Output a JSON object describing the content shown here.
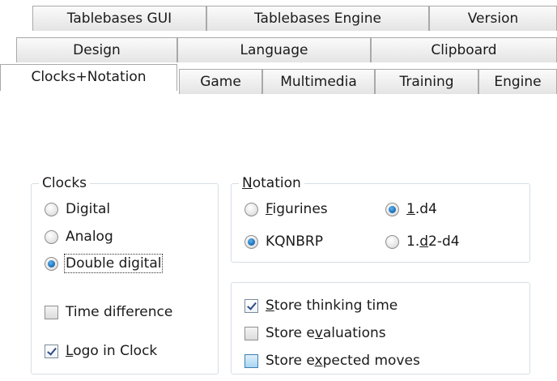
{
  "tabs": {
    "row1": [
      "Tablebases GUI",
      "Tablebases Engine",
      "Version"
    ],
    "row2": [
      "Design",
      "Language",
      "Clipboard"
    ],
    "row3": [
      "Clocks+Notation",
      "Game",
      "Multimedia",
      "Training",
      "Engine"
    ],
    "active": "Clocks+Notation"
  },
  "clocks": {
    "title": "Clocks",
    "options": [
      {
        "label": "Digital",
        "selected": false
      },
      {
        "label": "Analog",
        "selected": false
      },
      {
        "label": "Double digital",
        "selected": true
      }
    ],
    "time_difference": {
      "label": "Time difference",
      "checked": false
    },
    "logo_in_clock": {
      "label_u": "L",
      "label_rest": "ogo in Clock",
      "checked": true
    }
  },
  "notation": {
    "title_u": "N",
    "title_rest": "otation",
    "figurines": {
      "label_u": "F",
      "label_rest": "igurines",
      "selected": false
    },
    "kqnbrp": {
      "label": "KQNBRP",
      "selected": true
    },
    "short": {
      "label_u": "1",
      "label_rest": ".d4",
      "selected": true
    },
    "long": {
      "label_a": "1.",
      "label_u": "d",
      "label_rest": "2-d4",
      "selected": false
    }
  },
  "store": {
    "thinking_time": {
      "label_u": "S",
      "label_rest": "tore thinking time",
      "checked": true
    },
    "evaluations": {
      "label_a": "Store e",
      "label_u": "v",
      "label_rest": "aluations",
      "checked": false
    },
    "expected_moves": {
      "label_a": "Store e",
      "label_u": "x",
      "label_rest": "pected moves",
      "checked": false
    }
  }
}
